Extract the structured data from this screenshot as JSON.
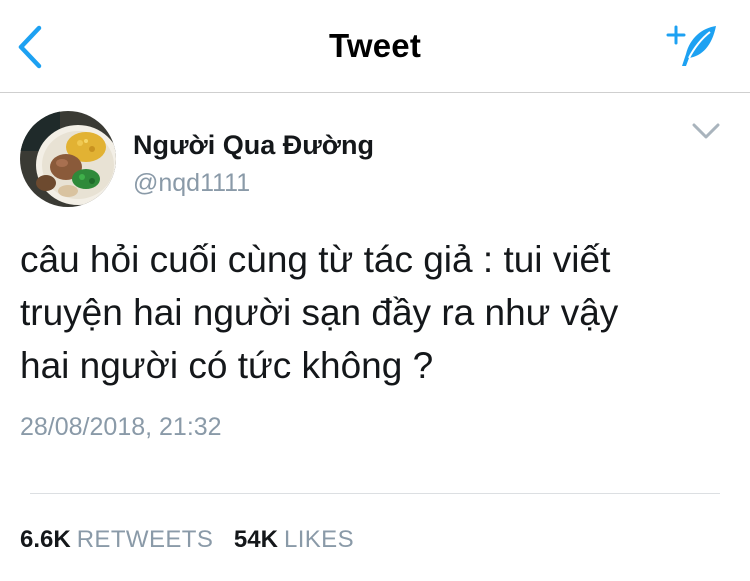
{
  "header": {
    "title": "Tweet",
    "back_icon": "chevron-left-icon",
    "compose_icon": "compose-feather-icon",
    "accent_color": "#1da1f2"
  },
  "tweet": {
    "author": {
      "display_name": "Người Qua Đường",
      "handle": "@nqd1111",
      "avatar_icon": "food-bowl-avatar"
    },
    "menu_icon": "chevron-down-icon",
    "text": "câu hỏi cuối cùng từ tác giả : tui viết\ntruyện hai người sạn đầy ra như vậy\nhai người có tức không ?",
    "timestamp": "28/08/2018, 21:32"
  },
  "stats": {
    "retweets_count": "6.6K",
    "retweets_label": "RETWEETS",
    "likes_count": "54K",
    "likes_label": "LIKES"
  },
  "colors": {
    "text": "#14171a",
    "secondary": "#8a9aa8",
    "divider": "#dcdfe2"
  }
}
